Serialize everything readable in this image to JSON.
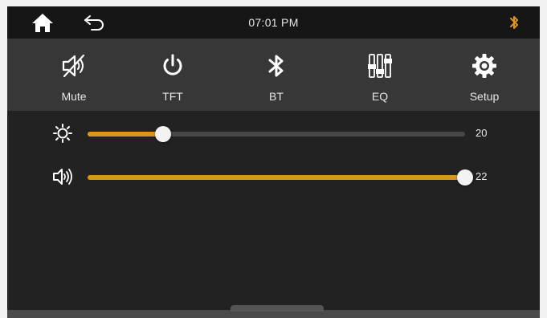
{
  "statusbar": {
    "time": "07:01  PM",
    "home_icon": "home-icon",
    "back_icon": "back-arrow-icon",
    "bluetooth_status_icon": "bluetooth-icon",
    "accent": "#d9961b"
  },
  "toolbar": {
    "items": [
      {
        "label": "Mute",
        "icon": "mute-speaker-icon"
      },
      {
        "label": "TFT",
        "icon": "power-icon"
      },
      {
        "label": "BT",
        "icon": "bluetooth-icon"
      },
      {
        "label": "EQ",
        "icon": "equalizer-icon"
      },
      {
        "label": "Setup",
        "icon": "gear-icon"
      }
    ]
  },
  "sliders": {
    "brightness": {
      "icon": "brightness-sun-icon",
      "value": "20",
      "fraction": 0.2
    },
    "volume": {
      "icon": "volume-speaker-icon",
      "value": "22",
      "fraction": 1.0
    }
  },
  "colors": {
    "fill": "#d9961b",
    "track": "#474747",
    "background": "#222222",
    "toolbar": "#373737"
  }
}
